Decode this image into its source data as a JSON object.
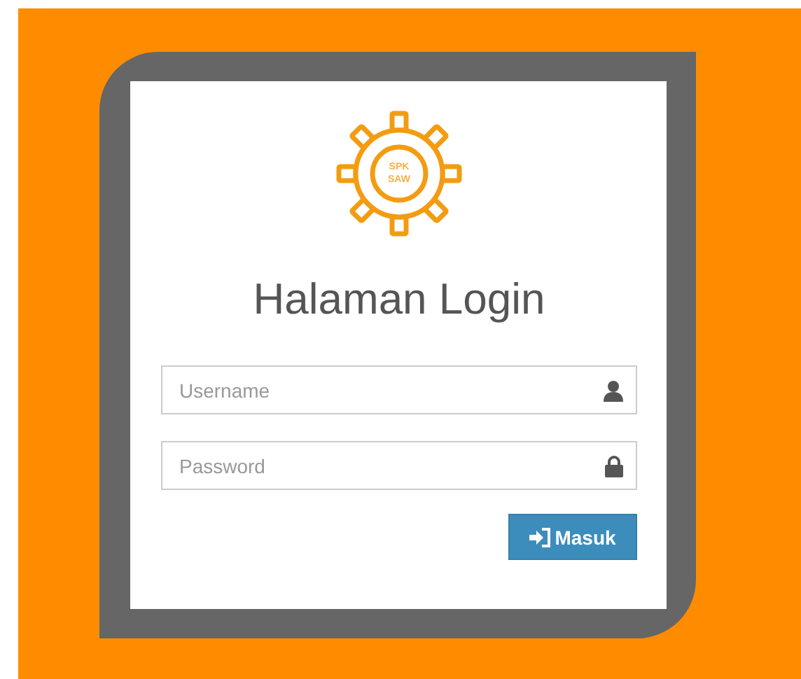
{
  "logo": {
    "lines": [
      "SPK",
      "SAW"
    ]
  },
  "title": "Halaman Login",
  "fields": [
    {
      "placeholder": "Username",
      "kind": "user"
    },
    {
      "placeholder": "Password",
      "kind": "lock"
    }
  ],
  "submit": {
    "label": "Masuk"
  }
}
